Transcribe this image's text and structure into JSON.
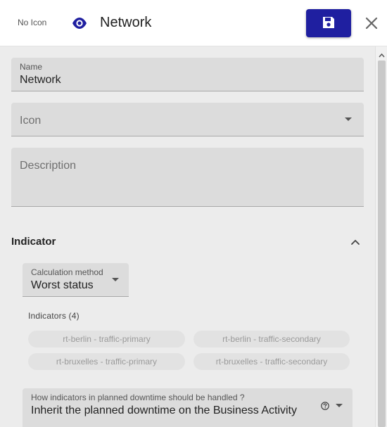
{
  "header": {
    "no_icon_label": "No Icon",
    "title": "Network",
    "eye_icon": "eye-icon",
    "save_icon": "floppy-disk-icon",
    "close_icon": "close-icon",
    "accent_color": "#1f1fa0"
  },
  "form": {
    "name": {
      "label": "Name",
      "value": "Network"
    },
    "icon": {
      "placeholder": "Icon"
    },
    "description": {
      "placeholder": "Description"
    }
  },
  "indicator_section": {
    "title": "Indicator",
    "calculation_method": {
      "label": "Calculation method",
      "value": "Worst status"
    },
    "indicators_title": "Indicators (4)",
    "indicators": [
      "rt-berlin - traffic-primary",
      "rt-berlin - traffic-secondary",
      "rt-bruxelles - traffic-primary",
      "rt-bruxelles - traffic-secondary"
    ],
    "downtime": {
      "label": "How indicators in planned downtime should be handled ?",
      "value": "Inherit the planned downtime on the Business Activity"
    }
  }
}
